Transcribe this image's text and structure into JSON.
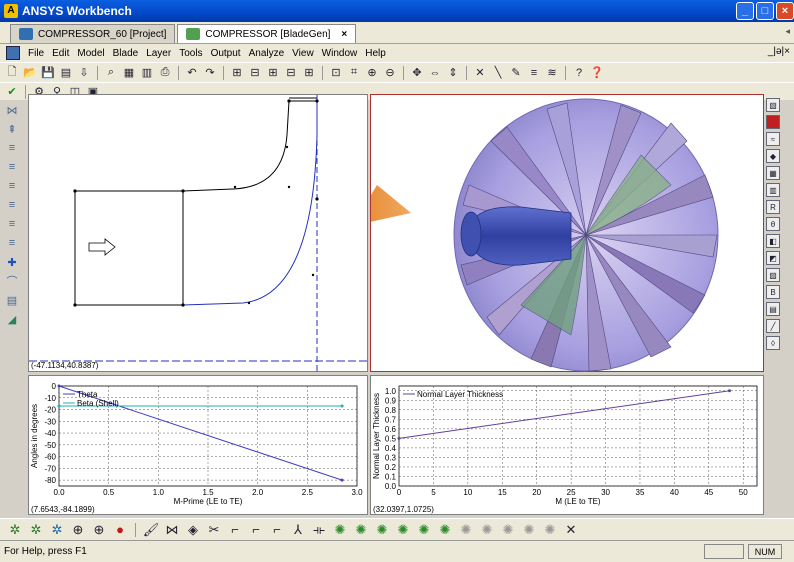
{
  "window": {
    "title": "ANSYS Workbench"
  },
  "tabs": [
    {
      "label": "COMPRESSOR_60 [Project]",
      "active": false
    },
    {
      "label": "COMPRESSOR [BladeGen]",
      "active": true,
      "close": "×"
    }
  ],
  "menu": [
    "File",
    "Edit",
    "Model",
    "Blade",
    "Layer",
    "Tools",
    "Output",
    "Analyze",
    "View",
    "Window",
    "Help"
  ],
  "mdi_controls": "_|ǝ|×",
  "meridional": {
    "coord": "(-47.1134,40.8387)"
  },
  "angle_plot": {
    "coord": "(7.6543,-84.1899)",
    "chart_data": {
      "type": "line",
      "x": [
        0.0,
        2.85
      ],
      "series": [
        {
          "name": "Theta",
          "color": "#4040c0",
          "values": [
            0.0,
            -80.0
          ]
        },
        {
          "name": "Beta (Shell)",
          "color": "#20b0b0",
          "values": [
            -17.0,
            -17.0
          ]
        }
      ],
      "xlabel": "M-Prime (LE to TE)",
      "ylabel": "Angles in degrees",
      "xlim": [
        0.0,
        3.0
      ],
      "ylim": [
        -85,
        0
      ],
      "xticks": [
        "0.0",
        "0.5",
        "1.0",
        "1.5",
        "2.0",
        "2.5",
        "3.0"
      ],
      "yticks": [
        "0",
        "-10",
        "-20",
        "-30",
        "-40",
        "-50",
        "-60",
        "-70",
        "-80"
      ],
      "grid": true
    }
  },
  "thickness_plot": {
    "coord": "(32.0397,1.0725)",
    "chart_data": {
      "type": "line",
      "x": [
        0,
        48
      ],
      "series": [
        {
          "name": "Normal Layer Thickness",
          "color": "#6040a0",
          "values": [
            0.5,
            1.0
          ]
        }
      ],
      "xlabel": "M (LE to TE)",
      "ylabel": "Normal Layer Thickness",
      "xlim": [
        0,
        52
      ],
      "ylim": [
        0,
        1.05
      ],
      "xticks": [
        "0",
        "5",
        "10",
        "15",
        "20",
        "25",
        "30",
        "35",
        "40",
        "45",
        "50"
      ],
      "yticks": [
        "0.0",
        "0.1",
        "0.2",
        "0.3",
        "0.4",
        "0.5",
        "0.6",
        "0.7",
        "0.8",
        "0.9",
        "1.0"
      ],
      "grid": true
    }
  },
  "status": {
    "help": "For Help, press F1",
    "num": "NUM"
  },
  "toolbar_icons": [
    "new-file-icon",
    "open-icon",
    "save-icon",
    "print-icon",
    "undo-icon",
    "redo-icon",
    "zoom-in-icon",
    "zoom-out-icon",
    "help-icon"
  ],
  "colors": {
    "title_bar": "#0348c9",
    "face": "#ece9d8",
    "panel_3d_border": "#b03030"
  }
}
